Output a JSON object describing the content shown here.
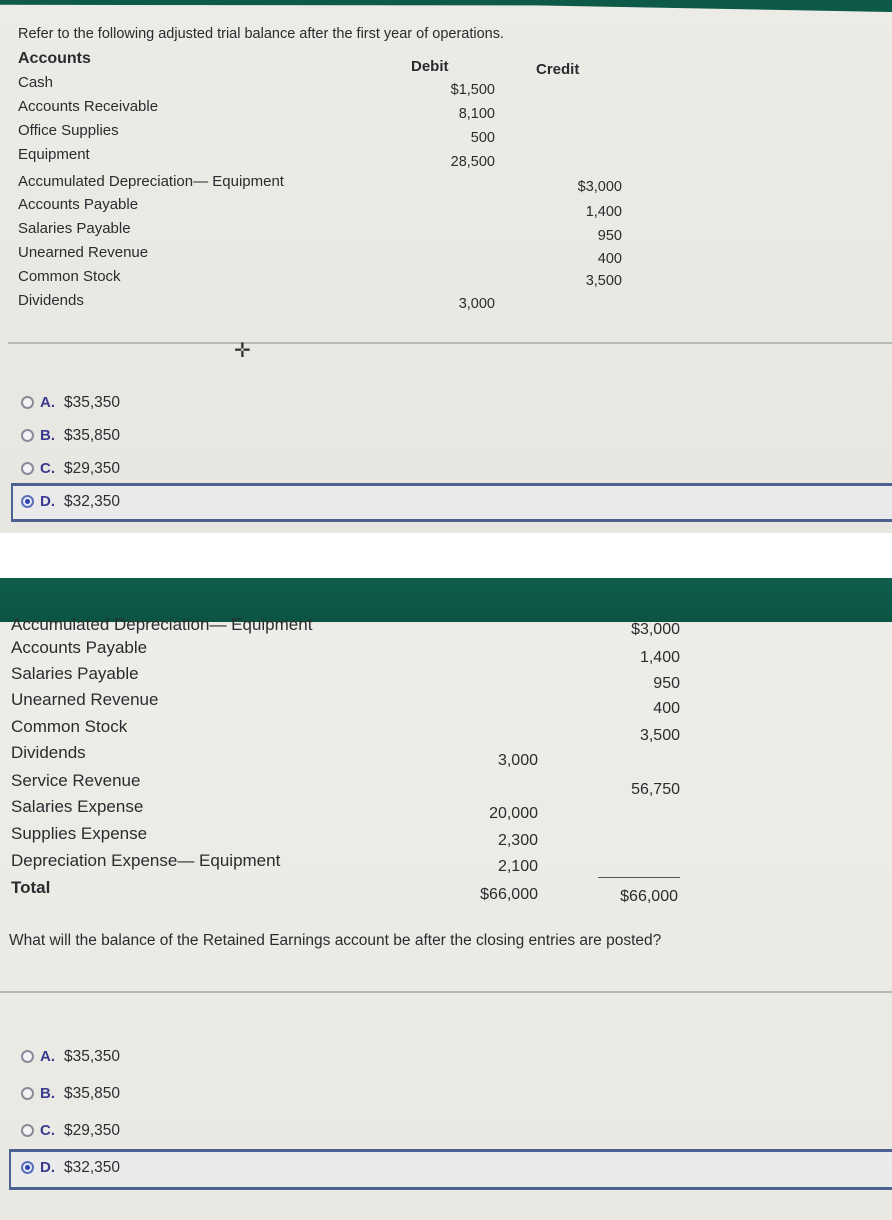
{
  "top_panel": {
    "intro": "Refer to the following adjusted trial balance after the first year of operations.",
    "headers": {
      "accounts": "Accounts",
      "debit": "Debit",
      "credit": "Credit"
    },
    "rows": [
      {
        "account": "Cash",
        "debit": "$1,500",
        "credit": ""
      },
      {
        "account": "Accounts Receivable",
        "debit": "8,100",
        "credit": ""
      },
      {
        "account": "Office Supplies",
        "debit": "500",
        "credit": ""
      },
      {
        "account": "Equipment",
        "debit": "28,500",
        "credit": ""
      },
      {
        "account": "Accumulated Depreciation— Equipment",
        "debit": "",
        "credit": "$3,000"
      },
      {
        "account": "Accounts Payable",
        "debit": "",
        "credit": "1,400"
      },
      {
        "account": "Salaries Payable",
        "debit": "",
        "credit": "950"
      },
      {
        "account": "Unearned Revenue",
        "debit": "",
        "credit": "400"
      },
      {
        "account": "Common Stock",
        "debit": "",
        "credit": "3,500"
      },
      {
        "account": "Dividends",
        "debit": "3,000",
        "credit": ""
      }
    ],
    "options": [
      {
        "letter": "A.",
        "value": "$35,350",
        "selected": false
      },
      {
        "letter": "B.",
        "value": "$35,850",
        "selected": false
      },
      {
        "letter": "C.",
        "value": "$29,350",
        "selected": false
      },
      {
        "letter": "D.",
        "value": "$32,350",
        "selected": true
      }
    ]
  },
  "bottom_panel": {
    "rows": [
      {
        "account": "Accumulated Depreciation— Equipment",
        "debit": "",
        "credit": "$3,000"
      },
      {
        "account": "Accounts Payable",
        "debit": "",
        "credit": "1,400"
      },
      {
        "account": "Salaries Payable",
        "debit": "",
        "credit": "950"
      },
      {
        "account": "Unearned Revenue",
        "debit": "",
        "credit": "400"
      },
      {
        "account": "Common Stock",
        "debit": "",
        "credit": "3,500"
      },
      {
        "account": "Dividends",
        "debit": "3,000",
        "credit": ""
      },
      {
        "account": "Service Revenue",
        "debit": "",
        "credit": "56,750"
      },
      {
        "account": "Salaries Expense",
        "debit": "20,000",
        "credit": ""
      },
      {
        "account": "Supplies Expense",
        "debit": "2,300",
        "credit": ""
      },
      {
        "account": "Depreciation Expense— Equipment",
        "debit": "2,100",
        "credit": ""
      }
    ],
    "total": {
      "label": "Total",
      "debit": "$66,000",
      "credit": "$66,000"
    },
    "question": "What will the balance of the Retained Earnings account be after the closing entries are posted?",
    "options": [
      {
        "letter": "A.",
        "value": "$35,350",
        "selected": false
      },
      {
        "letter": "B.",
        "value": "$35,850",
        "selected": false
      },
      {
        "letter": "C.",
        "value": "$29,350",
        "selected": false
      },
      {
        "letter": "D.",
        "value": "$32,350",
        "selected": true
      }
    ]
  },
  "colors": {
    "header_green": "#0d5a48",
    "selected_border": "#4c6391",
    "option_letter": "#3b3b8f",
    "radio_dot": "#2d44b0"
  }
}
